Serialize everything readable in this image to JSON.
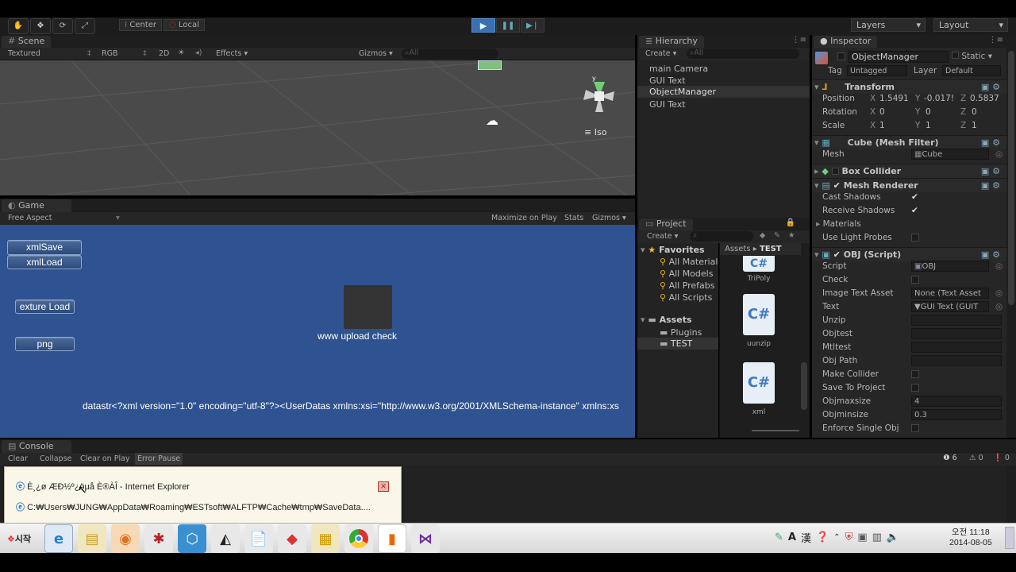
{
  "toolbar": {
    "center_label": "Center",
    "local_label": "Local",
    "layers_label": "Layers",
    "layout_label": "Layout"
  },
  "scene": {
    "tab": "Scene",
    "shading": "Textured",
    "rgb": "RGB",
    "mode_2d": "2D",
    "effects": "Effects",
    "gizmos": "Gizmos",
    "search_placeholder": "All",
    "iso_label": "Iso"
  },
  "game": {
    "tab": "Game",
    "aspect": "Free Aspect",
    "maximize": "Maximize on Play",
    "stats": "Stats",
    "gizmos": "Gizmos",
    "buttons": [
      "xmlSave",
      "xmlLoad",
      "exture Load",
      "png"
    ],
    "upload_label": "www upload check",
    "datastr": "datastr<?xml version=\"1.0\" encoding=\"utf-8\"?><UserDatas xmlns:xsi=\"http://www.w3.org/2001/XMLSchema-instance\" xmlns:xs"
  },
  "hierarchy": {
    "tab": "Hierarchy",
    "create": "Create",
    "search_placeholder": "All",
    "items": [
      "main Camera",
      "GUI Text",
      "ObjectManager",
      "GUI Text"
    ]
  },
  "project": {
    "tab": "Project",
    "create": "Create",
    "favorites_label": "Favorites",
    "favorites": [
      "All Material",
      "All Models",
      "All Prefabs",
      "All Scripts"
    ],
    "assets_label": "Assets",
    "assets": [
      "Plugins",
      "TEST"
    ],
    "breadcrumb_root": "Assets",
    "breadcrumb_leaf": "TEST",
    "files": [
      "TriPoly",
      "uunzip",
      "xml"
    ]
  },
  "inspector": {
    "tab": "Inspector",
    "object_name": "ObjectManager",
    "static_label": "Static",
    "tag_label": "Tag",
    "tag_value": "Untagged",
    "layer_label": "Layer",
    "layer_value": "Default",
    "transform": {
      "title": "Transform",
      "position_label": "Position",
      "rotation_label": "Rotation",
      "scale_label": "Scale",
      "position": [
        "1.5491",
        "-0.017!",
        "0.5837"
      ],
      "rotation": [
        "0",
        "0",
        "0"
      ],
      "scale": [
        "1",
        "1",
        "1"
      ]
    },
    "mesh_filter": {
      "title": "Cube (Mesh Filter)",
      "mesh_label": "Mesh",
      "mesh_value": "Cube"
    },
    "box_collider": {
      "title": "Box Collider"
    },
    "mesh_renderer": {
      "title": "Mesh Renderer",
      "cast_shadows": "Cast Shadows",
      "receive_shadows": "Receive Shadows",
      "materials": "Materials",
      "light_probes": "Use Light Probes"
    },
    "obj_script": {
      "title": "OBJ (Script)",
      "fields": [
        {
          "label": "Script",
          "value": "OBJ"
        },
        {
          "label": "Check",
          "value": ""
        },
        {
          "label": "Image Text Asset",
          "value": "None (Text Asset"
        },
        {
          "label": "Text",
          "value": "GUI Text (GUIT"
        },
        {
          "label": "Unzip",
          "value": ""
        },
        {
          "label": "Objtest",
          "value": ""
        },
        {
          "label": "Mtltest",
          "value": ""
        },
        {
          "label": "Obj Path",
          "value": ""
        },
        {
          "label": "Make Collider",
          "value": ""
        },
        {
          "label": "Save To Project",
          "value": ""
        },
        {
          "label": "Objmaxsize",
          "value": "4"
        },
        {
          "label": "Objminsize",
          "value": "0.3"
        },
        {
          "label": "Enforce Single Obj",
          "value": ""
        }
      ]
    }
  },
  "console": {
    "tab": "Console",
    "clear": "Clear",
    "collapse": "Collapse",
    "clear_on_play": "Clear on Play",
    "error_pause": "Error Pause",
    "counts": [
      "6",
      "0",
      "0"
    ]
  },
  "popup": {
    "item1": "È¸¿ø ÆÐ½º¿öµå È®ÀÎ - Internet Explorer",
    "item2": "C:₩Users₩JUNG₩AppData₩Roaming₩ESTsoft₩ALFTP₩Cache₩tmp₩SaveData...."
  },
  "taskbar": {
    "start_label": "시작",
    "tray_a": "A",
    "tray_han": "漢",
    "clock_time": "오전 11:18",
    "clock_date": "2014-08-05"
  },
  "colors": {
    "game_bg": "#2f5391",
    "unity_dark": "#1f1f1f",
    "taskbar": "#e9e9e9"
  }
}
